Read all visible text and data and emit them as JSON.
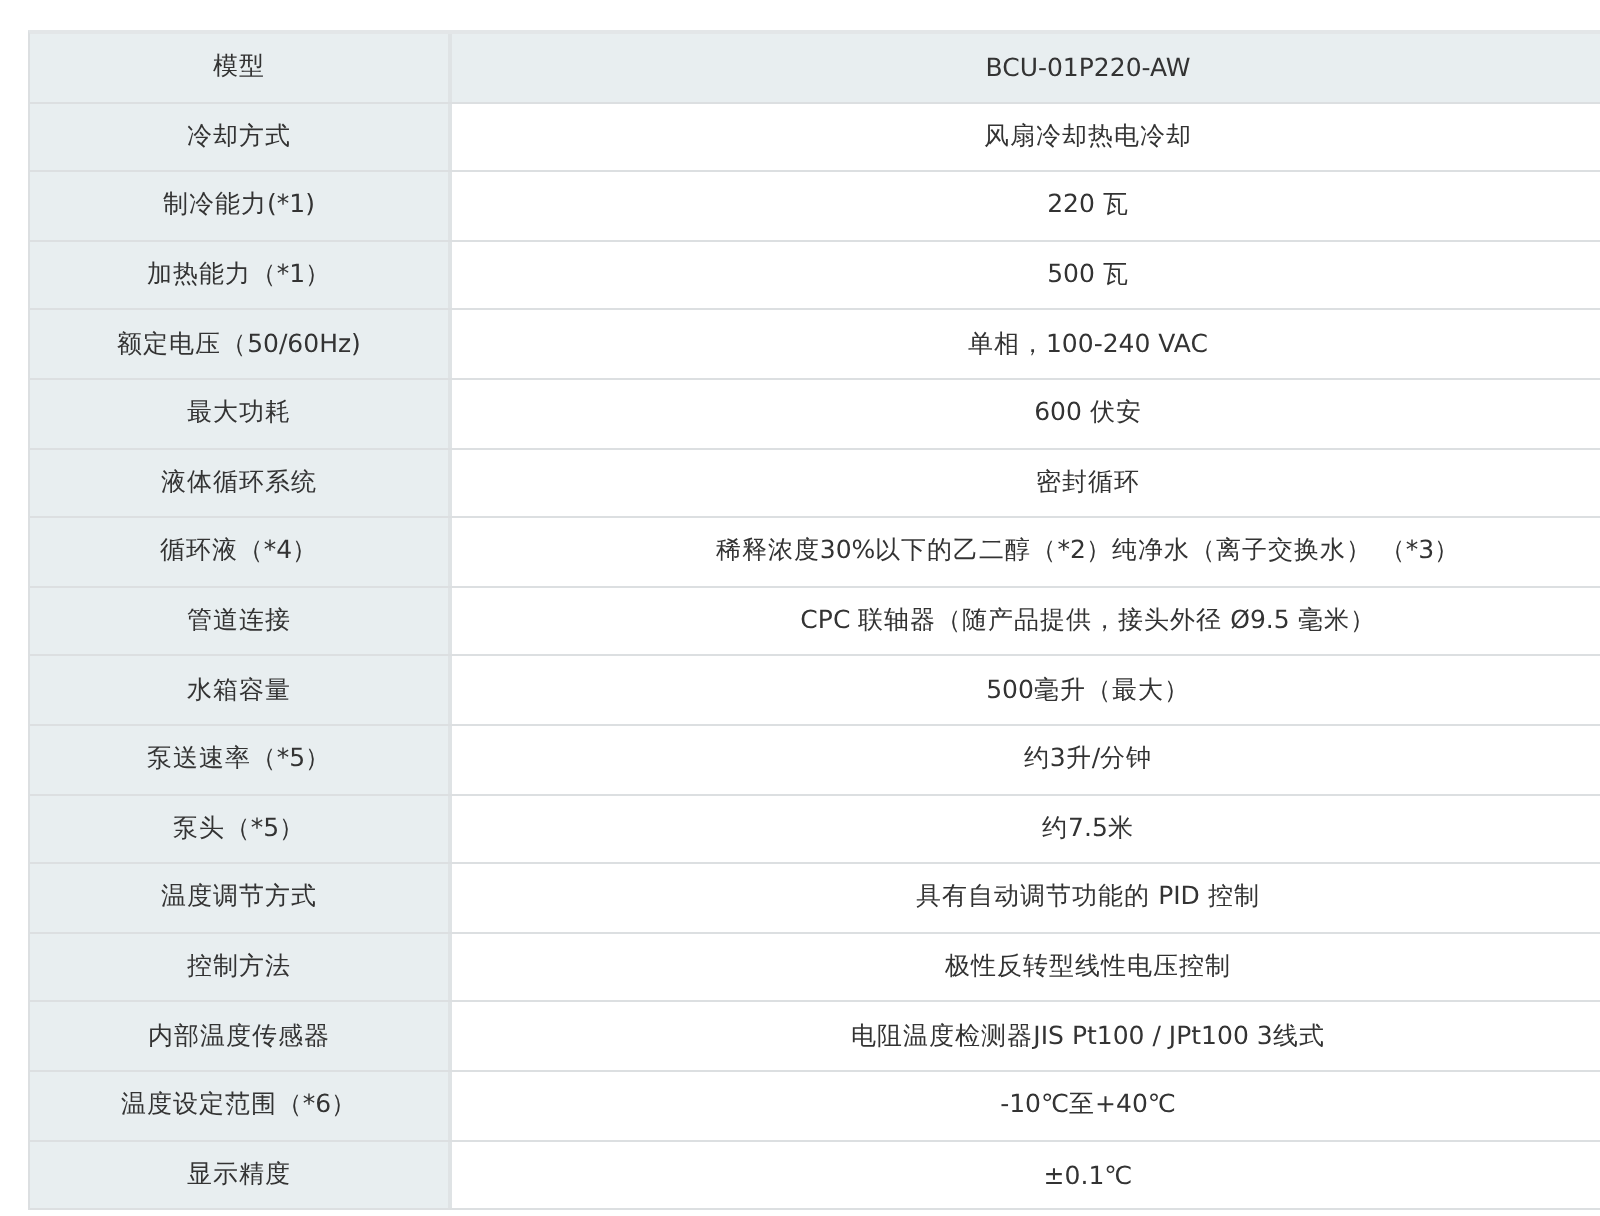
{
  "spec_table": {
    "rows": [
      {
        "kind": "header",
        "label": "模型",
        "value": "BCU-01P220-AW"
      },
      {
        "kind": "spec",
        "label": "冷却方式",
        "value": "风扇冷却热电冷却"
      },
      {
        "kind": "spec",
        "label": "制冷能力(*1)",
        "value": "220 瓦"
      },
      {
        "kind": "spec",
        "label": "加热能力（*1）",
        "value": "500 瓦"
      },
      {
        "kind": "spec",
        "label": "额定电压（50/60Hz)",
        "value": "单相，100-240 VAC"
      },
      {
        "kind": "spec",
        "label": "最大功耗",
        "value": "600 伏安"
      },
      {
        "kind": "spec",
        "label": "液体循环系统",
        "value": "密封循环"
      },
      {
        "kind": "spec",
        "label": "循环液（*4）",
        "value": "稀释浓度30%以下的乙二醇（*2）纯净水（离子交换水）  （*3）"
      },
      {
        "kind": "spec",
        "label": "管道连接",
        "value": "CPC 联轴器（随产品提供，接头外径 Ø9.5 毫米）"
      },
      {
        "kind": "spec",
        "label": "水箱容量",
        "value": "500毫升（最大）"
      },
      {
        "kind": "spec",
        "label": "泵送速率（*5）",
        "value": "约3升/分钟"
      },
      {
        "kind": "spec",
        "label": "泵头（*5）",
        "value": "约7.5米"
      },
      {
        "kind": "spec",
        "label": "温度调节方式",
        "value": "具有自动调节功能的 PID 控制"
      },
      {
        "kind": "spec",
        "label": "控制方法",
        "value": "极性反转型线性电压控制"
      },
      {
        "kind": "spec",
        "label": "内部温度传感器",
        "value": "电阻温度检测器JIS Pt100 / JPt100 3线式"
      },
      {
        "kind": "spec",
        "label": "温度设定范围（*6）",
        "value": "-10℃至+40℃"
      },
      {
        "kind": "spec",
        "label": "显示精度",
        "value": "±0.1℃"
      }
    ]
  }
}
